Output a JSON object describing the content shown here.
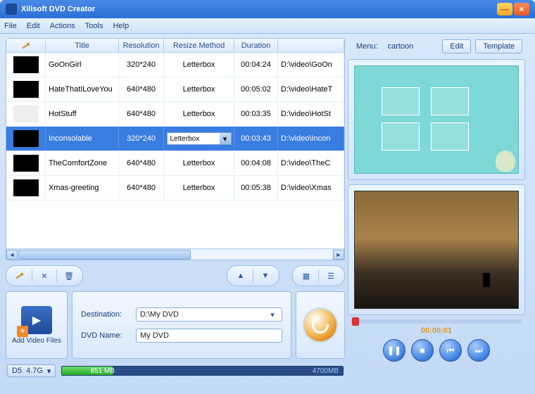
{
  "window": {
    "title": "Xilisoft DVD Creator"
  },
  "menubar": [
    "File",
    "Edit",
    "Actions",
    "Tools",
    "Help"
  ],
  "table": {
    "headers": {
      "title": "Title",
      "resolution": "Resolution",
      "resize": "Resize Method",
      "duration": "Duration"
    },
    "rows": [
      {
        "title": "GoOnGirl",
        "resolution": "320*240",
        "resize": "Letterbox",
        "duration": "00:04:24",
        "path": "D:\\video\\GoOn",
        "thumb": "dark"
      },
      {
        "title": "HateThatILoveYou",
        "resolution": "640*480",
        "resize": "Letterbox",
        "duration": "00:05:02",
        "path": "D:\\video\\HateT",
        "thumb": "dark"
      },
      {
        "title": "HotStuff",
        "resolution": "640*480",
        "resize": "Letterbox",
        "duration": "00:03:35",
        "path": "D:\\video\\HotSt",
        "thumb": "light"
      },
      {
        "title": "Inconsolable",
        "resolution": "320*240",
        "resize": "Letterbox",
        "duration": "00:03:43",
        "path": "D:\\video\\Incon",
        "thumb": "dark",
        "selected": true
      },
      {
        "title": "TheComfortZone",
        "resolution": "640*480",
        "resize": "Letterbox",
        "duration": "00:04:08",
        "path": "D:\\video\\TheC",
        "thumb": "dark"
      },
      {
        "title": "Xmas-greeting",
        "resolution": "640*480",
        "resize": "Letterbox",
        "duration": "00:05:38",
        "path": "D:\\video\\Xmas",
        "thumb": "dark"
      }
    ]
  },
  "add_label": "Add Video Files",
  "destination": {
    "label": "Destination:",
    "value": "D:\\My DVD"
  },
  "dvd_name": {
    "label": "DVD Name:",
    "value": "My DVD"
  },
  "disc": {
    "type": "D5",
    "size": "4.7G",
    "used": "851 MB",
    "total": "4700MB"
  },
  "menu": {
    "label": "Menu:",
    "name": "cartoon",
    "edit": "Edit",
    "template": "Template"
  },
  "player": {
    "time": "00:00:01"
  }
}
